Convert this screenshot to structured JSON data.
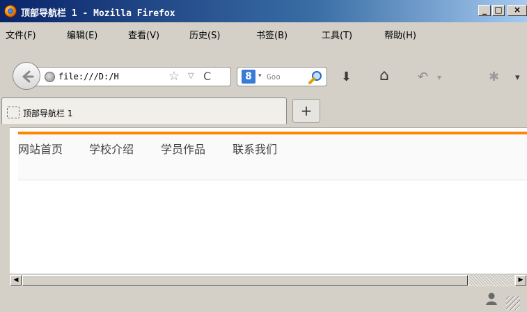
{
  "window": {
    "title": "顶部导航栏 1 - Mozilla Firefox",
    "min_glyph": "_",
    "max_glyph": "□",
    "close_glyph": "×"
  },
  "menubar": {
    "items": [
      "文件(F)",
      "编辑(E)",
      "查看(V)",
      "历史(S)",
      "书签(B)",
      "工具(T)",
      "帮助(H)"
    ]
  },
  "navbar": {
    "url": "file:///D:/H",
    "search_placeholder": "Goo",
    "search_engine_glyph": "8",
    "star_glyph": "☆",
    "dropdown_glyph": "▽",
    "reload_glyph": "C",
    "download_glyph": "⬇",
    "home_glyph": "⌂",
    "undo_glyph": "↶",
    "menu_caret_glyph": "▾",
    "more_glyph": "✱",
    "more_caret_glyph": "▾"
  },
  "tabs": {
    "active_label": "顶部导航栏 1",
    "new_tab_glyph": "+"
  },
  "page": {
    "nav_links": [
      "网站首页",
      "学校介绍",
      "学员作品",
      "联系我们"
    ],
    "accent_color": "#ff8400"
  },
  "scrollbar": {
    "left_arrow": "◀",
    "right_arrow": "▶"
  }
}
